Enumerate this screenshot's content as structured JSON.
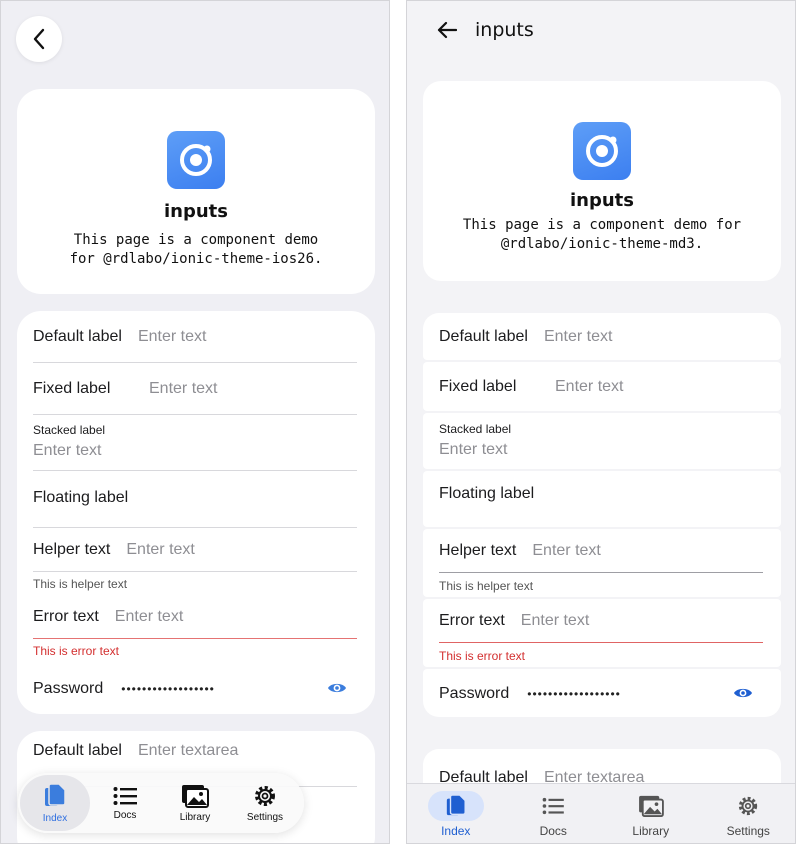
{
  "ios": {
    "hero": {
      "title": "inputs",
      "desc_line1": "This page is a component demo",
      "desc_line2": "for @rdlabo/ionic-theme-ios26."
    },
    "fields": {
      "default_label": "Default label",
      "default_placeholder": "Enter text",
      "fixed_label": "Fixed label",
      "fixed_placeholder": "Enter text",
      "stacked_label": "Stacked label",
      "stacked_placeholder": "Enter text",
      "floating_label": "Floating label",
      "helper_label": "Helper text",
      "helper_placeholder": "Enter text",
      "helper_note": "This is helper text",
      "error_label": "Error text",
      "error_placeholder": "Enter text",
      "error_note": "This is error text",
      "password_label": "Password",
      "password_value": "••••••••••••••••••",
      "textarea_label": "Default label",
      "textarea_placeholder": "Enter textarea"
    },
    "tabs": [
      {
        "label": "Index",
        "icon": "documents-icon"
      },
      {
        "label": "Docs",
        "icon": "list-icon"
      },
      {
        "label": "Library",
        "icon": "images-icon"
      },
      {
        "label": "Settings",
        "icon": "settings-icon"
      }
    ]
  },
  "md": {
    "header": {
      "title": "inputs"
    },
    "hero": {
      "title": "inputs",
      "desc_line1": "This page is a component demo for",
      "desc_line2": "@rdlabo/ionic-theme-md3."
    },
    "fields": {
      "default_label": "Default label",
      "default_placeholder": "Enter text",
      "fixed_label": "Fixed label",
      "fixed_placeholder": "Enter text",
      "stacked_label": "Stacked label",
      "stacked_placeholder": "Enter text",
      "floating_label": "Floating label",
      "helper_label": "Helper text",
      "helper_placeholder": "Enter text",
      "helper_note": "This is helper text",
      "error_label": "Error text",
      "error_placeholder": "Enter text",
      "error_note": "This is error text",
      "password_label": "Password",
      "password_value": "••••••••••••••••••",
      "textarea_label": "Default label",
      "textarea_placeholder": "Enter textarea"
    },
    "tabs": [
      {
        "label": "Index",
        "icon": "documents-icon"
      },
      {
        "label": "Docs",
        "icon": "list-icon"
      },
      {
        "label": "Library",
        "icon": "images-icon"
      },
      {
        "label": "Settings",
        "icon": "settings-icon"
      }
    ]
  },
  "colors": {
    "accent": "#3b7ddd",
    "error": "#d32f2f"
  }
}
